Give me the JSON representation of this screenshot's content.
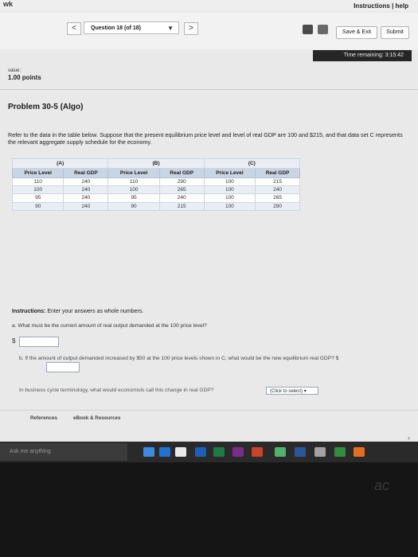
{
  "header": {
    "brand": "wk",
    "help_links": "Instructions | help"
  },
  "question_nav": {
    "prev": "<",
    "selector_label": "Question 18 (of 18)",
    "next": ">",
    "save_exit": "Save & Exit",
    "submit": "Submit"
  },
  "timer": {
    "label": "Time remaining: 3:15:42"
  },
  "value": {
    "label": "value:",
    "points": "1.00 points"
  },
  "problem": {
    "title": "Problem 30-5 (Algo)",
    "body": "Refer to the data in the table below. Suppose that the present equilibrium price level and level of real GDP are 100 and $215, and that data set C represents the relevant aggregate supply schedule for the economy."
  },
  "table": {
    "groups": [
      "(A)",
      "(B)",
      "(C)"
    ],
    "columns": [
      "Price Level",
      "Real GDP",
      "Price Level",
      "Real GDP",
      "Price Level",
      "Real GDP"
    ],
    "rows": [
      [
        "110",
        "240",
        "110",
        "290",
        "100",
        "215"
      ],
      [
        "100",
        "240",
        "100",
        "265",
        "100",
        "240"
      ],
      [
        "95",
        "240",
        "95",
        "240",
        "100",
        "265"
      ],
      [
        "90",
        "240",
        "90",
        "215",
        "100",
        "290"
      ]
    ]
  },
  "instructions": {
    "prefix": "Instructions:",
    "text": " Enter your answers as whole numbers."
  },
  "questions": {
    "a": "a. What must be the current amount of real output demanded at the 100 price level?",
    "a_prefix": "$",
    "b": "b. If the amount of output demanded increased by $50 at the 100 price levels shown in C, what would be the new equilibrium real GDP? $",
    "c": "In business cycle terminology, what would economists call this change in real GDP?",
    "c_select": "(Click to select)"
  },
  "footer": {
    "references": "References",
    "ebook": "eBook & Resources"
  },
  "taskbar": {
    "search_placeholder": "Ask me anything"
  },
  "monitor": {
    "brand": "ac"
  }
}
